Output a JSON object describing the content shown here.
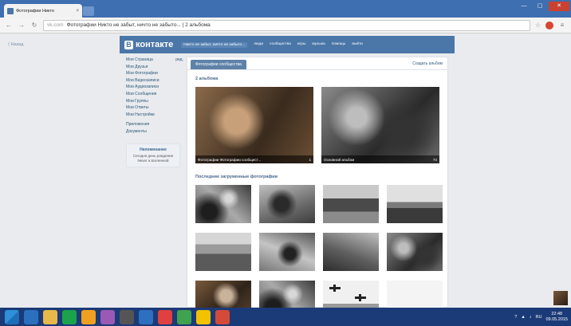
{
  "browser": {
    "tab_title": "Фотографии Никто",
    "tab_close": "×",
    "window_buttons": [
      "—",
      "▢",
      "✕"
    ],
    "address": {
      "domain": "vk.com",
      "page_title": "Фотографии Никто не забыт, ничто не забыто... | 2 альбома"
    }
  },
  "page": {
    "back_link": "⟨ Назад",
    "header": {
      "logo_letter": "В",
      "logo_text": "контакте",
      "nav": [
        "Никто не забыт, ничто не забыто...",
        "люди",
        "сообщества",
        "игры",
        "музыка",
        "помощь",
        "выйти"
      ]
    },
    "sidebar": {
      "items": [
        {
          "label": "Моя Страница",
          "extra": "ред."
        },
        {
          "label": "Мои Друзья",
          "extra": ""
        },
        {
          "label": "Мои Фотографии",
          "extra": ""
        },
        {
          "label": "Мои Видеозаписи",
          "extra": ""
        },
        {
          "label": "Мои Аудиозаписи",
          "extra": ""
        },
        {
          "label": "Мои Сообщения",
          "extra": ""
        },
        {
          "label": "Мои Группы",
          "extra": ""
        },
        {
          "label": "Мои Ответы",
          "extra": ""
        },
        {
          "label": "Мои Настройки",
          "extra": ""
        }
      ],
      "extra_items": [
        "Приложения",
        "Документы"
      ],
      "notice": {
        "title": "Напоминание",
        "body": "Сегодня день рождения Never a вселенной"
      }
    },
    "content": {
      "active_tab": "Фотографии сообщества",
      "create_album": "Создать альбом",
      "albums_title": "2 альбома",
      "albums": [
        {
          "caption": "Фотографии Фотографии сообщест...",
          "count": "1"
        },
        {
          "caption": "Основной альбом",
          "count": "74"
        }
      ],
      "recent_title": "Последние загруженные фотографии"
    }
  },
  "taskbar": {
    "time": "22:48",
    "date": "09.05.2015",
    "lang": "RU"
  },
  "colors": {
    "vk_blue": "#4a76a8",
    "titlebar": "#3e6fb0",
    "taskbar": "#1b3a78"
  }
}
